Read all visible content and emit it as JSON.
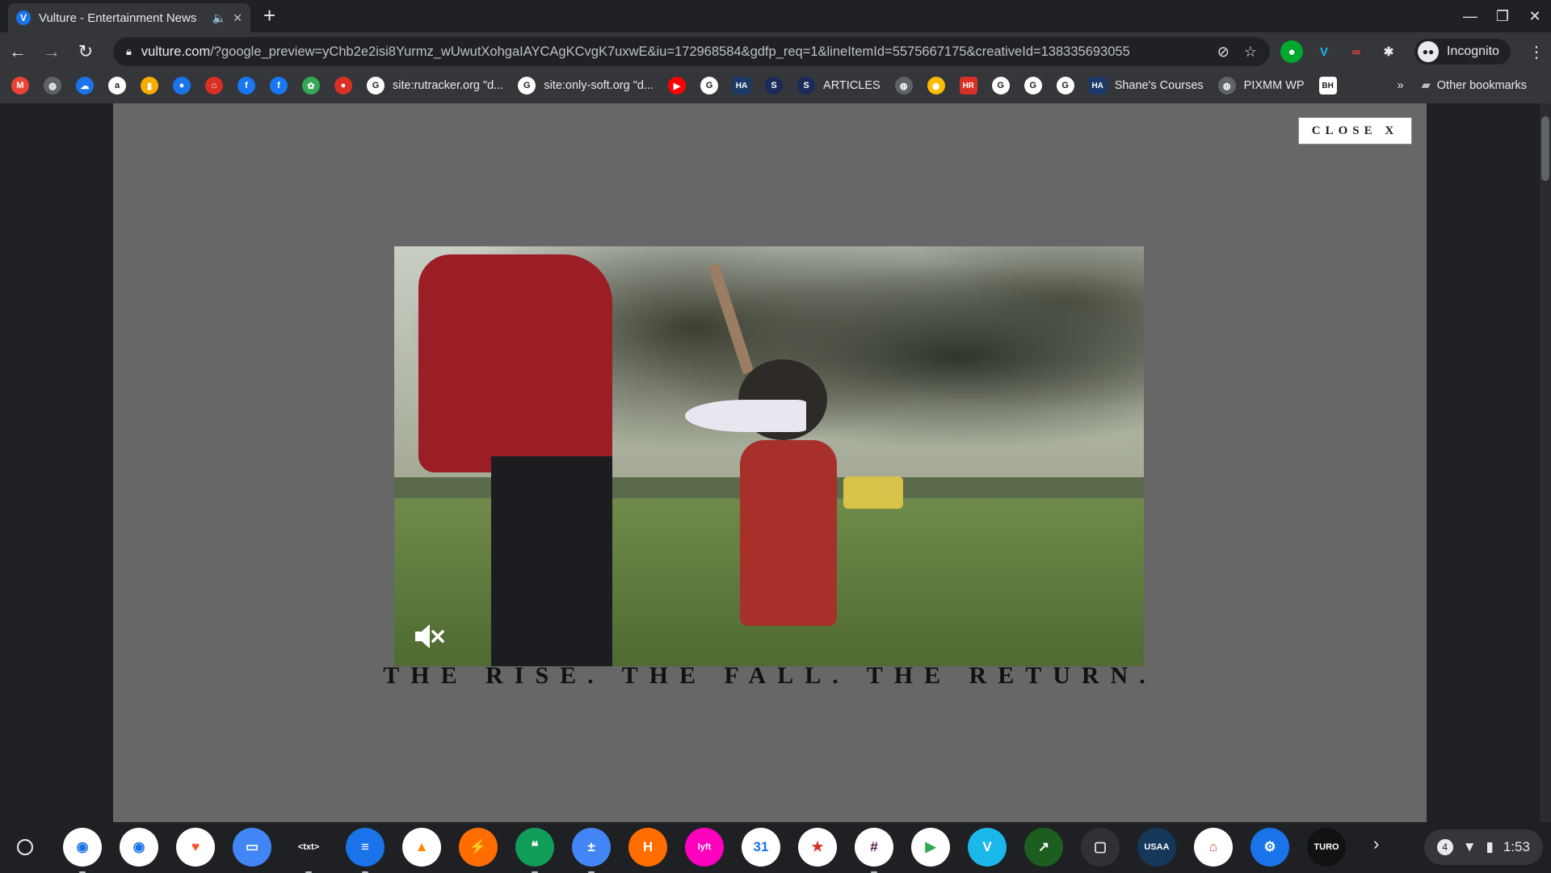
{
  "tab": {
    "title": "Vulture - Entertainment News",
    "favicon": "V"
  },
  "address": {
    "domain": "vulture.com",
    "path": "/?google_preview=yChb2e2isi8Yurmz_wUwutXohgaIAYCAgKCvgK7uxwE&iu=172968584&gdfp_req=1&lineItemId=5575667175&creativeId=138335693055"
  },
  "profile": {
    "label": "Incognito"
  },
  "bookmarks": [
    {
      "label": "",
      "icon": "gmail-icon",
      "color": "#ea4335",
      "glyph": "M"
    },
    {
      "label": "",
      "icon": "globe-icon",
      "color": "#5f6368",
      "glyph": "◍"
    },
    {
      "label": "",
      "icon": "cloud-icon",
      "color": "#1a73e8",
      "glyph": "☁"
    },
    {
      "label": "",
      "icon": "amazon-icon",
      "color": "#ffffff",
      "glyph": "a"
    },
    {
      "label": "",
      "icon": "bars-icon",
      "color": "#f9ab00",
      "glyph": "▮"
    },
    {
      "label": "",
      "icon": "chat-icon",
      "color": "#1a73e8",
      "glyph": "●"
    },
    {
      "label": "",
      "icon": "home-icon",
      "color": "#d93025",
      "glyph": "⌂"
    },
    {
      "label": "",
      "icon": "facebook-icon",
      "color": "#1877f2",
      "glyph": "f"
    },
    {
      "label": "",
      "icon": "facebook-icon",
      "color": "#1877f2",
      "glyph": "f"
    },
    {
      "label": "",
      "icon": "photos-icon",
      "color": "#34a853",
      "glyph": "✿"
    },
    {
      "label": "",
      "icon": "record-icon",
      "color": "#d93025",
      "glyph": "●"
    },
    {
      "label": "site:rutracker.org \"d...",
      "icon": "google-icon",
      "color": "#ffffff",
      "glyph": "G"
    },
    {
      "label": "site:only-soft.org \"d...",
      "icon": "google-icon",
      "color": "#ffffff",
      "glyph": "G"
    },
    {
      "label": "",
      "icon": "youtube-icon",
      "color": "#ff0000",
      "glyph": "▶"
    },
    {
      "label": "",
      "icon": "google-icon",
      "color": "#ffffff",
      "glyph": "G"
    },
    {
      "label": "",
      "icon": "ha-icon",
      "color": "#1a3a6a",
      "glyph": "HA"
    },
    {
      "label": "",
      "icon": "s-icon",
      "color": "#1a2a5a",
      "glyph": "S"
    },
    {
      "label": "ARTICLES",
      "icon": "s-icon",
      "color": "#1a2a5a",
      "glyph": "S"
    },
    {
      "label": "",
      "icon": "globe-icon",
      "color": "#5f6368",
      "glyph": "◍"
    },
    {
      "label": "",
      "icon": "chrome-icon",
      "color": "#fbbc04",
      "glyph": "◉"
    },
    {
      "label": "",
      "icon": "hr-icon",
      "color": "#d93025",
      "glyph": "HR"
    },
    {
      "label": "",
      "icon": "google-icon",
      "color": "#ffffff",
      "glyph": "G"
    },
    {
      "label": "",
      "icon": "google-icon",
      "color": "#ffffff",
      "glyph": "G"
    },
    {
      "label": "",
      "icon": "google-icon",
      "color": "#ffffff",
      "glyph": "G"
    },
    {
      "label": "Shane's Courses",
      "icon": "ha-icon",
      "color": "#1a3a6a",
      "glyph": "HA"
    },
    {
      "label": "PIXMM WP",
      "icon": "globe-icon",
      "color": "#5f6368",
      "glyph": "◍"
    },
    {
      "label": "",
      "icon": "bh-icon",
      "color": "#ffffff",
      "glyph": "BH"
    }
  ],
  "bookmarks_more": "»",
  "other_bookmarks": "Other bookmarks",
  "ad": {
    "close_label": "CLOSE X",
    "tagline": "THE RISE. THE FALL. THE RETURN."
  },
  "shelf": {
    "apps": [
      {
        "icon": "chrome-icon",
        "color": "#ffffff",
        "glyph": "◉",
        "fg": "#1a73e8",
        "running": true
      },
      {
        "icon": "chrome-beta-icon",
        "color": "#ffffff",
        "glyph": "◉",
        "fg": "#1a73e8",
        "running": false
      },
      {
        "icon": "brave-icon",
        "color": "#ffffff",
        "glyph": "♥",
        "fg": "#fb542b",
        "running": false
      },
      {
        "icon": "files-icon",
        "color": "#4285f4",
        "glyph": "▭",
        "fg": "#ffffff",
        "running": false
      },
      {
        "icon": "text-icon",
        "color": "#202124",
        "glyph": "<txt>",
        "fg": "#ffffff",
        "running": true
      },
      {
        "icon": "messages-icon",
        "color": "#1a73e8",
        "glyph": "≡",
        "fg": "#ffffff",
        "running": true
      },
      {
        "icon": "vlc-icon",
        "color": "#ffffff",
        "glyph": "▲",
        "fg": "#ff8800",
        "running": false
      },
      {
        "icon": "flash-icon",
        "color": "#ff6d00",
        "glyph": "⚡",
        "fg": "#ffffff",
        "running": false
      },
      {
        "icon": "hangouts-icon",
        "color": "#0f9d58",
        "glyph": "❝",
        "fg": "#ffffff",
        "running": true
      },
      {
        "icon": "calculator-icon",
        "color": "#4285f4",
        "glyph": "±",
        "fg": "#ffffff",
        "running": true
      },
      {
        "icon": "honey-icon",
        "color": "#ff6d00",
        "glyph": "H",
        "fg": "#ffffff",
        "running": false
      },
      {
        "icon": "lyft-icon",
        "color": "#ff00bf",
        "glyph": "lyft",
        "fg": "#ffffff",
        "running": false
      },
      {
        "icon": "calendar-icon",
        "color": "#ffffff",
        "glyph": "31",
        "fg": "#1a73e8",
        "running": false
      },
      {
        "icon": "bookmark-icon",
        "color": "#ffffff",
        "glyph": "★",
        "fg": "#d93025",
        "running": false
      },
      {
        "icon": "slack-icon",
        "color": "#ffffff",
        "glyph": "#",
        "fg": "#4a154b",
        "running": true
      },
      {
        "icon": "play-store-icon",
        "color": "#ffffff",
        "glyph": "▶",
        "fg": "#34a853",
        "running": false
      },
      {
        "icon": "vimeo-icon",
        "color": "#1ab7ea",
        "glyph": "V",
        "fg": "#ffffff",
        "running": false
      },
      {
        "icon": "stocks-icon",
        "color": "#1b5e20",
        "glyph": "↗",
        "fg": "#ffffff",
        "running": false
      },
      {
        "icon": "window-icon",
        "color": "#303134",
        "glyph": "▢",
        "fg": "#e8eaed",
        "running": false
      },
      {
        "icon": "usaa-icon",
        "color": "#14375a",
        "glyph": "USAA",
        "fg": "#ffffff",
        "running": false
      },
      {
        "icon": "google-home-icon",
        "color": "#ffffff",
        "glyph": "⌂",
        "fg": "#ea4335",
        "running": false
      },
      {
        "icon": "settings-icon",
        "color": "#1a73e8",
        "glyph": "⚙",
        "fg": "#ffffff",
        "running": false
      },
      {
        "icon": "turo-icon",
        "color": "#121212",
        "glyph": "TURO",
        "fg": "#ffffff",
        "running": false
      }
    ],
    "tray": {
      "notifications": "4",
      "time": "1:53"
    }
  }
}
